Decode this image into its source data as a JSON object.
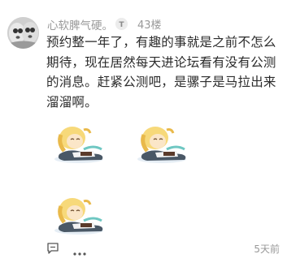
{
  "post": {
    "username": "心软脾气硬。",
    "badge_letter": "T",
    "floor": "43楼",
    "content": "预约整一年了，有趣的事就是之前不怎么期待，现在居然每天进论坛看有没有公测的消息。赶紧公测吧，是骡子是马拉出来溜溜啊。",
    "time": "5天前"
  },
  "stickers": [
    {
      "name": "sleeping-character-sticker"
    },
    {
      "name": "sleeping-character-sticker"
    },
    {
      "name": "sleeping-character-sticker"
    }
  ],
  "icons": {
    "avatar": "avatar",
    "badge": "level-badge-icon",
    "comment": "comment-icon",
    "more": "more-options-icon"
  }
}
